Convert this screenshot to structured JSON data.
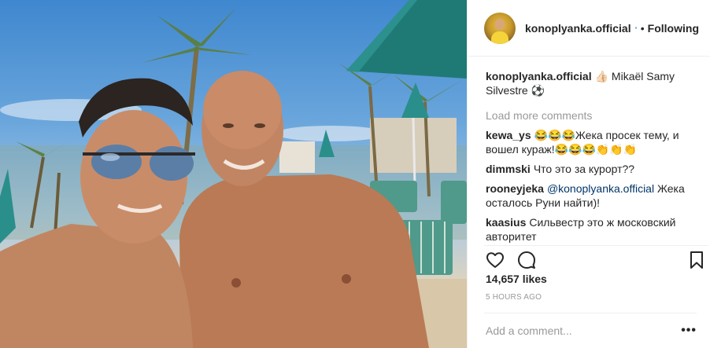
{
  "post": {
    "username": "konoplyanka.official",
    "follow_state": "Following",
    "separator": "•"
  },
  "caption": {
    "username": "konoplyanka.official",
    "text": "👍🏻 Mikaël Samy Silvestre ⚽"
  },
  "load_more_label": "Load more comments",
  "comments": [
    {
      "username": "kewa_ys",
      "text": "😂😂😂Жека просек тему, и вошел кураж!😂😂😂👏👏👏"
    },
    {
      "username": "dimmski",
      "text": "Что это за курорт??"
    },
    {
      "username": "rooneyjeka",
      "mention": "@konoplyanka.official",
      "text": " Жека осталось Руни найти)!"
    },
    {
      "username": "kaasius",
      "text": "Сильвестр это ж московский авторитет"
    }
  ],
  "likes_label": "14,657 likes",
  "time_ago": "5 HOURS AGO",
  "add_comment_placeholder": "Add a comment...",
  "more_options_label": "•••",
  "icons": {
    "verified": "verified-badge-icon",
    "like": "heart-icon",
    "comment": "speech-bubble-icon",
    "save": "bookmark-icon"
  },
  "colors": {
    "verified": "#3897f0",
    "muted": "#999999",
    "mention": "#003569",
    "border": "#efefef"
  }
}
